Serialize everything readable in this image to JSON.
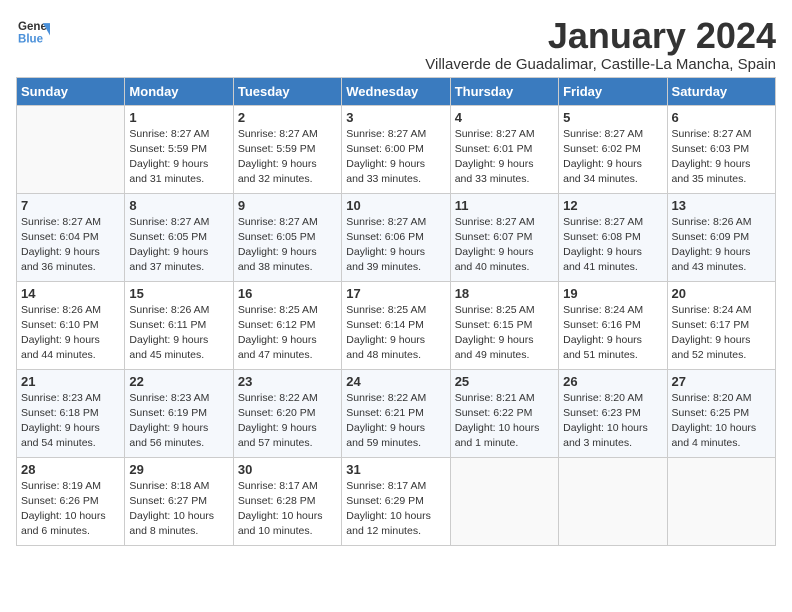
{
  "header": {
    "logo_line1": "General",
    "logo_line2": "Blue",
    "title": "January 2024",
    "subtitle": "Villaverde de Guadalimar, Castille-La Mancha, Spain"
  },
  "weekdays": [
    "Sunday",
    "Monday",
    "Tuesday",
    "Wednesday",
    "Thursday",
    "Friday",
    "Saturday"
  ],
  "weeks": [
    [
      {
        "day": "",
        "info": ""
      },
      {
        "day": "1",
        "info": "Sunrise: 8:27 AM\nSunset: 5:59 PM\nDaylight: 9 hours\nand 31 minutes."
      },
      {
        "day": "2",
        "info": "Sunrise: 8:27 AM\nSunset: 5:59 PM\nDaylight: 9 hours\nand 32 minutes."
      },
      {
        "day": "3",
        "info": "Sunrise: 8:27 AM\nSunset: 6:00 PM\nDaylight: 9 hours\nand 33 minutes."
      },
      {
        "day": "4",
        "info": "Sunrise: 8:27 AM\nSunset: 6:01 PM\nDaylight: 9 hours\nand 33 minutes."
      },
      {
        "day": "5",
        "info": "Sunrise: 8:27 AM\nSunset: 6:02 PM\nDaylight: 9 hours\nand 34 minutes."
      },
      {
        "day": "6",
        "info": "Sunrise: 8:27 AM\nSunset: 6:03 PM\nDaylight: 9 hours\nand 35 minutes."
      }
    ],
    [
      {
        "day": "7",
        "info": "Sunrise: 8:27 AM\nSunset: 6:04 PM\nDaylight: 9 hours\nand 36 minutes."
      },
      {
        "day": "8",
        "info": "Sunrise: 8:27 AM\nSunset: 6:05 PM\nDaylight: 9 hours\nand 37 minutes."
      },
      {
        "day": "9",
        "info": "Sunrise: 8:27 AM\nSunset: 6:05 PM\nDaylight: 9 hours\nand 38 minutes."
      },
      {
        "day": "10",
        "info": "Sunrise: 8:27 AM\nSunset: 6:06 PM\nDaylight: 9 hours\nand 39 minutes."
      },
      {
        "day": "11",
        "info": "Sunrise: 8:27 AM\nSunset: 6:07 PM\nDaylight: 9 hours\nand 40 minutes."
      },
      {
        "day": "12",
        "info": "Sunrise: 8:27 AM\nSunset: 6:08 PM\nDaylight: 9 hours\nand 41 minutes."
      },
      {
        "day": "13",
        "info": "Sunrise: 8:26 AM\nSunset: 6:09 PM\nDaylight: 9 hours\nand 43 minutes."
      }
    ],
    [
      {
        "day": "14",
        "info": "Sunrise: 8:26 AM\nSunset: 6:10 PM\nDaylight: 9 hours\nand 44 minutes."
      },
      {
        "day": "15",
        "info": "Sunrise: 8:26 AM\nSunset: 6:11 PM\nDaylight: 9 hours\nand 45 minutes."
      },
      {
        "day": "16",
        "info": "Sunrise: 8:25 AM\nSunset: 6:12 PM\nDaylight: 9 hours\nand 47 minutes."
      },
      {
        "day": "17",
        "info": "Sunrise: 8:25 AM\nSunset: 6:14 PM\nDaylight: 9 hours\nand 48 minutes."
      },
      {
        "day": "18",
        "info": "Sunrise: 8:25 AM\nSunset: 6:15 PM\nDaylight: 9 hours\nand 49 minutes."
      },
      {
        "day": "19",
        "info": "Sunrise: 8:24 AM\nSunset: 6:16 PM\nDaylight: 9 hours\nand 51 minutes."
      },
      {
        "day": "20",
        "info": "Sunrise: 8:24 AM\nSunset: 6:17 PM\nDaylight: 9 hours\nand 52 minutes."
      }
    ],
    [
      {
        "day": "21",
        "info": "Sunrise: 8:23 AM\nSunset: 6:18 PM\nDaylight: 9 hours\nand 54 minutes."
      },
      {
        "day": "22",
        "info": "Sunrise: 8:23 AM\nSunset: 6:19 PM\nDaylight: 9 hours\nand 56 minutes."
      },
      {
        "day": "23",
        "info": "Sunrise: 8:22 AM\nSunset: 6:20 PM\nDaylight: 9 hours\nand 57 minutes."
      },
      {
        "day": "24",
        "info": "Sunrise: 8:22 AM\nSunset: 6:21 PM\nDaylight: 9 hours\nand 59 minutes."
      },
      {
        "day": "25",
        "info": "Sunrise: 8:21 AM\nSunset: 6:22 PM\nDaylight: 10 hours\nand 1 minute."
      },
      {
        "day": "26",
        "info": "Sunrise: 8:20 AM\nSunset: 6:23 PM\nDaylight: 10 hours\nand 3 minutes."
      },
      {
        "day": "27",
        "info": "Sunrise: 8:20 AM\nSunset: 6:25 PM\nDaylight: 10 hours\nand 4 minutes."
      }
    ],
    [
      {
        "day": "28",
        "info": "Sunrise: 8:19 AM\nSunset: 6:26 PM\nDaylight: 10 hours\nand 6 minutes."
      },
      {
        "day": "29",
        "info": "Sunrise: 8:18 AM\nSunset: 6:27 PM\nDaylight: 10 hours\nand 8 minutes."
      },
      {
        "day": "30",
        "info": "Sunrise: 8:17 AM\nSunset: 6:28 PM\nDaylight: 10 hours\nand 10 minutes."
      },
      {
        "day": "31",
        "info": "Sunrise: 8:17 AM\nSunset: 6:29 PM\nDaylight: 10 hours\nand 12 minutes."
      },
      {
        "day": "",
        "info": ""
      },
      {
        "day": "",
        "info": ""
      },
      {
        "day": "",
        "info": ""
      }
    ]
  ]
}
